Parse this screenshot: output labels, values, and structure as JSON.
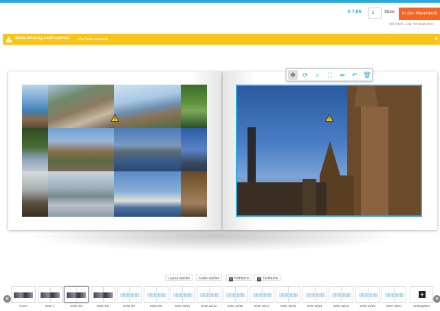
{
  "header": {
    "price": "€ 7,95",
    "quantity": "1",
    "unit": "Stück",
    "cart_button": "In den Warenkorb",
    "vat_note": "inkl. MwSt., zzgl. Versandkosten"
  },
  "warning": {
    "text": "Bildauflösung nicht optimal",
    "link": "(Zur Seite springen)",
    "close": "×"
  },
  "toolbar": {
    "icons": [
      "move-icon",
      "rotate-icon",
      "zoom-icon",
      "fit-icon",
      "flip-icon",
      "undo-icon",
      "delete-icon"
    ]
  },
  "layout_buttons": {
    "layout": "Layout wählen",
    "color": "Farbe wählen",
    "image_area": "Bildfläche",
    "text_area": "Textfläche"
  },
  "pages": {
    "prev": "«",
    "next": "»",
    "add": "+",
    "add_label": "Seitenpaket",
    "thumbs": [
      "Cover",
      "Seite 1",
      "Seite 2/3",
      "Seite 4/5",
      "Seite 6/7",
      "Seite 8/9",
      "Seite 10/11",
      "Seite 12/13",
      "Seite 14/15",
      "Seite 16/17",
      "Seite 18/19",
      "Seite 20/21",
      "Seite 22/23",
      "Seite 24/25",
      "Seite 26/27"
    ],
    "current": "Seite 2/3"
  },
  "colors": {
    "accent": "#29a8e0",
    "cart": "#f26522",
    "warning": "#f8c31a"
  }
}
